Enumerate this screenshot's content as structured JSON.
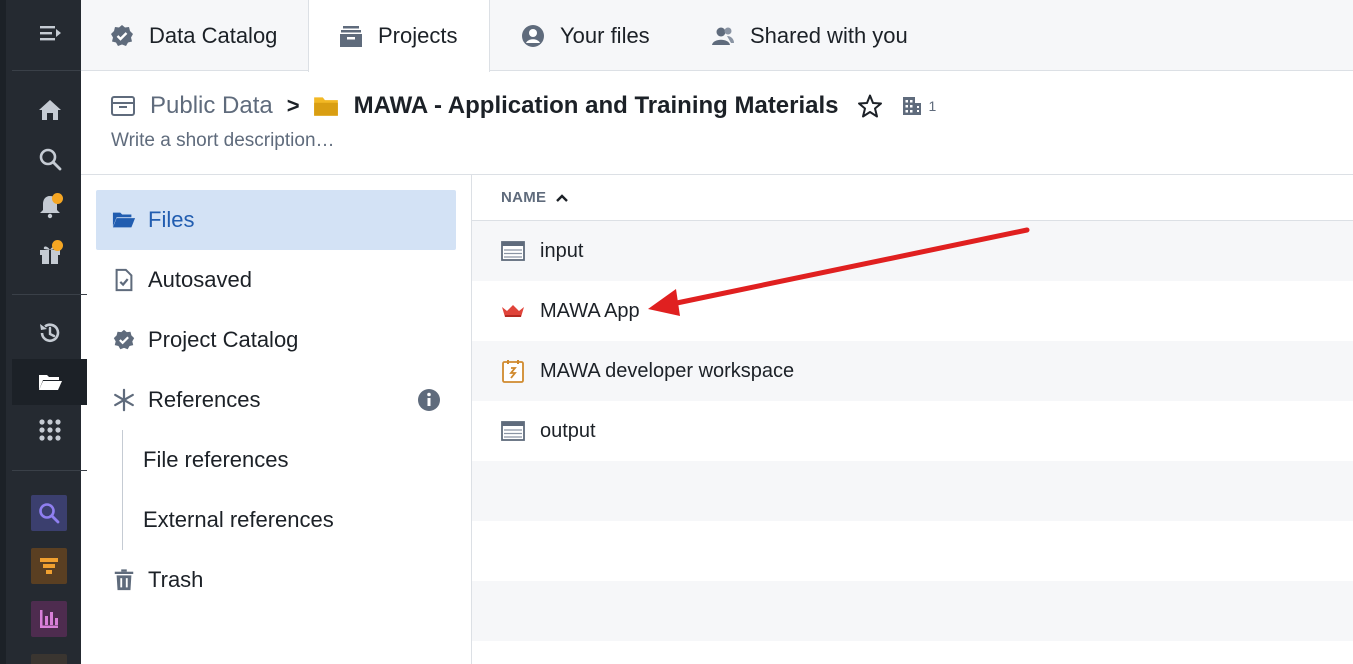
{
  "tabs": [
    {
      "label": "Data Catalog",
      "icon": "badge-check-icon"
    },
    {
      "label": "Projects",
      "icon": "archive-box-icon"
    },
    {
      "label": "Your files",
      "icon": "user-circle-icon"
    },
    {
      "label": "Shared with you",
      "icon": "people-icon"
    }
  ],
  "active_tab": "Projects",
  "breadcrumb": {
    "root": "Public Data",
    "separator": ">",
    "title": "MAWA - Application and Training Materials",
    "org_count": "1"
  },
  "description_placeholder": "Write a short description…",
  "nav": {
    "items": [
      {
        "label": "Files",
        "icon": "folder-open-icon",
        "active": true
      },
      {
        "label": "Autosaved",
        "icon": "document-check-icon"
      },
      {
        "label": "Project Catalog",
        "icon": "badge-check-icon"
      },
      {
        "label": "References",
        "icon": "asterisk-icon"
      },
      {
        "label": "Trash",
        "icon": "trash-icon"
      }
    ],
    "sub_items": [
      "File references",
      "External references"
    ]
  },
  "list": {
    "column_header": "NAME",
    "sort": "ascending",
    "rows": [
      {
        "name": "input",
        "icon": "dataset-icon"
      },
      {
        "name": "MAWA App",
        "icon": "crown-app-icon"
      },
      {
        "name": "MAWA developer workspace",
        "icon": "code-workspace-icon"
      },
      {
        "name": "output",
        "icon": "dataset-icon"
      }
    ]
  },
  "colors": {
    "rail_bg": "#252a31",
    "accent_blue": "#215db0",
    "active_nav_bg": "#d3e2f5",
    "notification_dot": "#f5a623",
    "folder_yellow": "#f2b824",
    "annotation_red": "#e02020"
  }
}
